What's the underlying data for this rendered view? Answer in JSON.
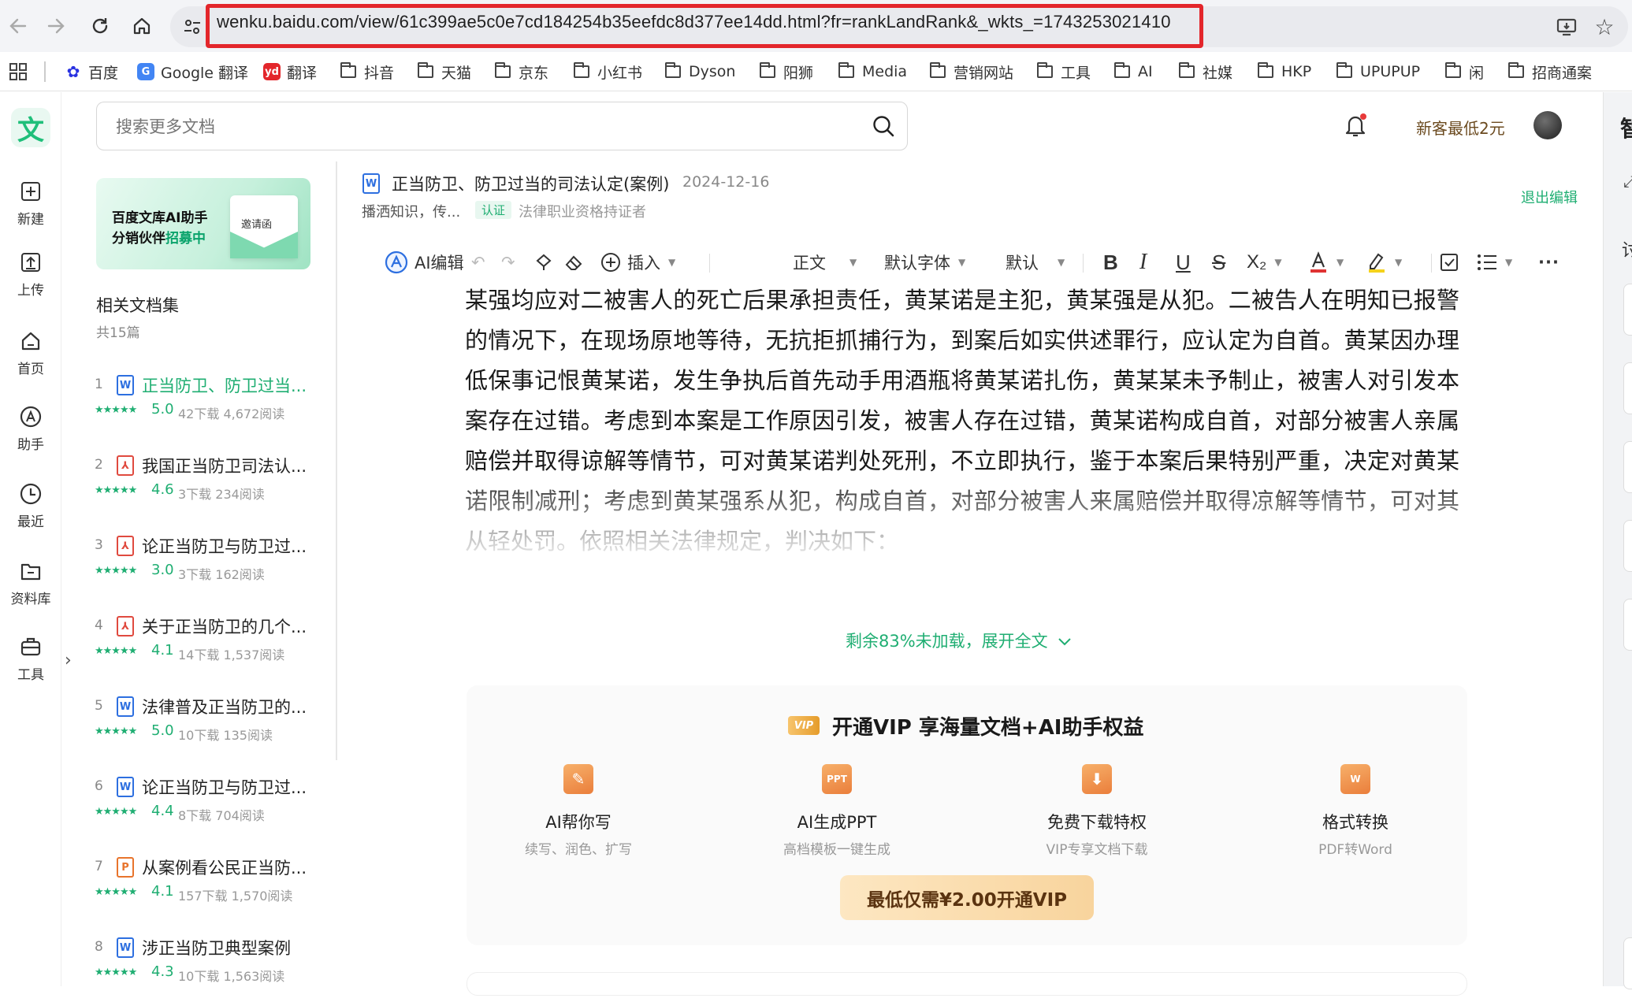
{
  "browser": {
    "address": "wenku.baidu.com/view/61c399ae5c0e7cd184254b35eefdc8d377ee14dd.html?fr=rankLandRank&_wkts_=1743253021410",
    "highlight_color": "#e3262b",
    "nav_icons": [
      "back-arrow-icon",
      "forward-arrow-icon",
      "reload-icon",
      "home-icon"
    ]
  },
  "bookmarks": [
    {
      "label": "百度",
      "icon": "baidu-paw-icon"
    },
    {
      "label": "Google 翻译",
      "icon": "google-translate-icon"
    },
    {
      "label": "翻译",
      "icon": "youdao-icon"
    },
    {
      "label": "抖音",
      "icon": "folder-icon"
    },
    {
      "label": "天猫",
      "icon": "folder-icon"
    },
    {
      "label": "京东",
      "icon": "folder-icon"
    },
    {
      "label": "小红书",
      "icon": "folder-icon"
    },
    {
      "label": "Dyson",
      "icon": "folder-icon"
    },
    {
      "label": "阳狮",
      "icon": "folder-icon"
    },
    {
      "label": "Media",
      "icon": "folder-icon"
    },
    {
      "label": "营销网站",
      "icon": "folder-icon"
    },
    {
      "label": "工具",
      "icon": "folder-icon"
    },
    {
      "label": "AI",
      "icon": "folder-icon"
    },
    {
      "label": "社媒",
      "icon": "folder-icon"
    },
    {
      "label": "HKP",
      "icon": "folder-icon"
    },
    {
      "label": "UPUPUP",
      "icon": "folder-icon"
    },
    {
      "label": "闲",
      "icon": "folder-icon"
    },
    {
      "label": "招商通案",
      "icon": "folder-icon"
    }
  ],
  "rail": {
    "logo": "文",
    "items": [
      {
        "label": "新建",
        "icon": "plus-icon"
      },
      {
        "label": "上传",
        "icon": "upload-icon"
      },
      {
        "label": "首页",
        "icon": "home-icon"
      },
      {
        "label": "助手",
        "icon": "assistant-icon"
      },
      {
        "label": "最近",
        "icon": "clock-icon"
      },
      {
        "label": "资料库",
        "icon": "folder-icon"
      },
      {
        "label": "工具",
        "icon": "toolbox-icon"
      }
    ],
    "toggle": "›"
  },
  "header": {
    "search_placeholder": "搜索更多文档",
    "promo": "新客最低2元"
  },
  "sidebar": {
    "banner_line1": "百度文库AI助手",
    "banner_line2_prefix": "分销伙伴",
    "banner_line2_highlight": "招募中",
    "banner_card": "邀请函",
    "related_title": "相关文档集",
    "related_count": "共15篇",
    "docs": [
      {
        "num": "1",
        "type": "W",
        "title": "正当防卫、防卫过当...",
        "stars": "★★★★★",
        "score": "5.0",
        "meta": "42下载  4,672阅读",
        "active": true
      },
      {
        "num": "2",
        "type": "PDF",
        "title": "我国正当防卫司法认...",
        "stars": "★★★★★",
        "score": "4.6",
        "meta": "3下载  234阅读"
      },
      {
        "num": "3",
        "type": "PDF",
        "title": "论正当防卫与防卫过...",
        "stars": "★★★★★",
        "score": "3.0",
        "meta": "3下载  162阅读"
      },
      {
        "num": "4",
        "type": "PDF",
        "title": "关于正当防卫的几个...",
        "stars": "★★★★★",
        "score": "4.1",
        "meta": "14下载  1,537阅读"
      },
      {
        "num": "5",
        "type": "W",
        "title": "法律普及正当防卫的...",
        "stars": "★★★★★",
        "score": "5.0",
        "meta": "10下载  135阅读"
      },
      {
        "num": "6",
        "type": "W",
        "title": "论正当防卫与防卫过...",
        "stars": "★★★★★",
        "score": "4.4",
        "meta": "8下载  704阅读"
      },
      {
        "num": "7",
        "type": "P",
        "title": "从案例看公民正当防...",
        "stars": "★★★★★",
        "score": "4.1",
        "meta": "157下载  1,570阅读"
      },
      {
        "num": "8",
        "type": "W",
        "title": "涉正当防卫典型案例",
        "stars": "★★★★★",
        "score": "4.3",
        "meta": "10下载  1,563阅读"
      }
    ]
  },
  "document": {
    "type_icon": "W",
    "title": "正当防卫、防卫过当的司法认定(案例)",
    "date": "2024-12-16",
    "author": "播洒知识，传...",
    "badge": "认证",
    "cert": "法律职业资格持证者",
    "exit_edit": "退出编辑",
    "body": "某强均应对二被害人的死亡后果承担责任，黄某诺是主犯，黄某强是从犯。二被告人在明知已报警的情况下，在现场原地等待，无抗拒抓捕行为，到案后如实供述罪行，应认定为自首。黄某因办理低保事记恨黄某诺，发生争执后首先动手用酒瓶将黄某诺扎伤，黄某某未予制止，被害人对引发本案存在过错。考虑到本案是工作原因引发，被害人存在过错，黄某诺构成自首，对部分被害人亲属赔偿并取得谅解等情节，可对黄某诺判处死刑，不立即执行，鉴于本案后果特别严重，决定对黄某诺限制减刑；考虑到黄某强系从犯，构成自首，对部分被害人来属赔偿并取得凉解等情节，可对其从轻处罚。依照相关法律规定，判决如下：",
    "expand": "剩余83%未加载，展开全文"
  },
  "toolbar": {
    "ai_edit": "AI编辑",
    "insert": "插入",
    "style": "正文",
    "font": "默认字体",
    "size": "默认",
    "bold": "B",
    "italic": "I",
    "underline": "U",
    "strike": "S",
    "subscript": "X₂"
  },
  "vip": {
    "badge": "VIP",
    "title": "开通VIP 享海量文档+AI助手权益",
    "features": [
      {
        "name": "AI帮你写",
        "desc": "续写、润色、扩写",
        "icon": "ai-write-icon"
      },
      {
        "name": "AI生成PPT",
        "desc": "高档模板一键生成",
        "icon_text": "PPT",
        "icon": "ppt-icon"
      },
      {
        "name": "免费下载特权",
        "desc": "VIP专享文档下载",
        "icon": "download-icon"
      },
      {
        "name": "格式转换",
        "desc": "PDF转Word",
        "icon_text": "W",
        "icon": "word-convert-icon"
      }
    ],
    "button": "最低仅需¥2.00开通VIP"
  },
  "right_panel": {
    "glyph": "智",
    "glyph2": "讨"
  },
  "colors": {
    "accent": "#1fae72",
    "word": "#2d6fe0",
    "pdf": "#e04a3f",
    "ppt": "#e8742c",
    "vip": "#e59c2b"
  }
}
